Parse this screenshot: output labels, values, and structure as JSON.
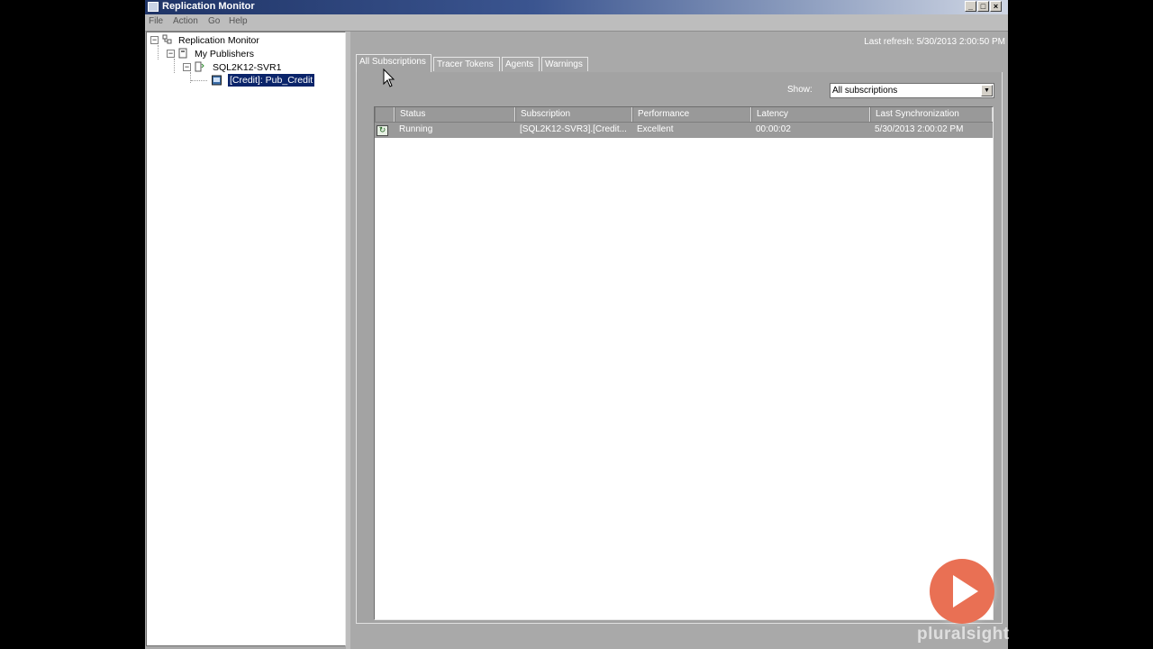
{
  "window": {
    "title": "Replication Monitor"
  },
  "menu": [
    "File",
    "Action",
    "Go",
    "Help"
  ],
  "tree": {
    "root": "Replication Monitor",
    "publishers": "My Publishers",
    "server": "SQL2K12-SVR1",
    "publication": "[Credit]: Pub_Credit"
  },
  "header": {
    "last_refresh": "Last refresh: 5/30/2013 2:00:50 PM"
  },
  "tabs": [
    "All Subscriptions",
    "Tracer Tokens",
    "Agents",
    "Warnings"
  ],
  "filter": {
    "label": "Show:",
    "selected": "All subscriptions"
  },
  "grid": {
    "columns": [
      "Status",
      "Subscription",
      "Performance",
      "Latency",
      "Last Synchronization"
    ],
    "rows": [
      {
        "status": "Running",
        "subscription": "[SQL2K12-SVR3].[Credit...",
        "performance": "Excellent",
        "latency": "00:00:02",
        "last_sync": "5/30/2013 2:00:02 PM"
      }
    ]
  },
  "watermark": {
    "text": "pluralsight",
    "color": "#e97054"
  }
}
